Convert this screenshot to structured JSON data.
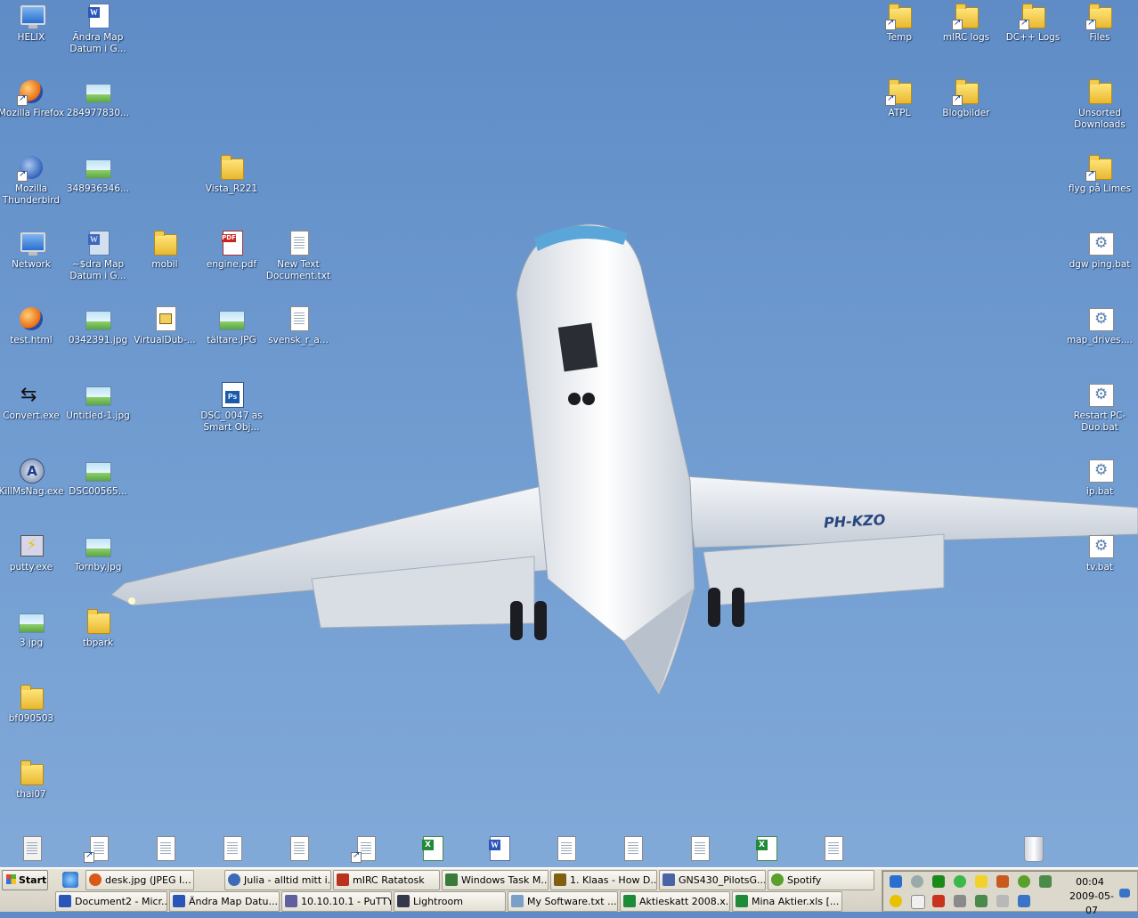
{
  "desktop": {
    "left_icons": [
      {
        "label": "HELIX",
        "icon": "monitor-icon"
      },
      {
        "label": "Ändra Map Datum i G...",
        "icon": "word-document-icon"
      },
      {
        "label": "Mozilla Firefox",
        "icon": "firefox-icon"
      },
      {
        "label": "284977830...",
        "icon": "image-file-icon"
      },
      {
        "label": "Mozilla Thunderbird",
        "icon": "thunderbird-icon"
      },
      {
        "label": "348936346...",
        "icon": "image-file-icon"
      },
      {
        "label": "Vista_R221",
        "icon": "folder-icon"
      },
      {
        "label": "Network",
        "icon": "network-icon"
      },
      {
        "label": "~$dra Map Datum i G...",
        "icon": "word-document-icon"
      },
      {
        "label": "mobil",
        "icon": "folder-icon"
      },
      {
        "label": "engine.pdf",
        "icon": "pdf-file-icon"
      },
      {
        "label": "New Text Document.txt",
        "icon": "text-file-icon"
      },
      {
        "label": "test.html",
        "icon": "firefox-icon"
      },
      {
        "label": "0342391.jpg",
        "icon": "image-file-icon"
      },
      {
        "label": "VirtualDub-...",
        "icon": "virtualdub-icon"
      },
      {
        "label": "tältare.JPG",
        "icon": "image-file-icon"
      },
      {
        "label": "svensk_r_a...",
        "icon": "text-file-icon"
      },
      {
        "label": "Convert.exe",
        "icon": "convert-arrows-icon"
      },
      {
        "label": "Untitled-1.jpg",
        "icon": "image-file-icon"
      },
      {
        "label": "DSC_0047 as Smart Obj...",
        "icon": "psd-file-icon"
      },
      {
        "label": "KillMsNag.exe",
        "icon": "killmsnag-icon"
      },
      {
        "label": "DSC00565...",
        "icon": "image-file-icon"
      },
      {
        "label": "putty.exe",
        "icon": "putty-icon"
      },
      {
        "label": "Tornby.jpg",
        "icon": "image-file-icon"
      },
      {
        "label": "3.jpg",
        "icon": "image-file-icon"
      },
      {
        "label": "tbpark",
        "icon": "folder-icon"
      },
      {
        "label": "bf090503",
        "icon": "folder-icon"
      },
      {
        "label": "thai07",
        "icon": "folder-icon"
      }
    ],
    "right_icons": [
      {
        "label": "Temp",
        "icon": "folder-shortcut-icon"
      },
      {
        "label": "mIRC logs",
        "icon": "folder-shortcut-icon"
      },
      {
        "label": "DC++ Logs",
        "icon": "folder-shortcut-icon"
      },
      {
        "label": "Files",
        "icon": "folder-shortcut-icon"
      },
      {
        "label": "ATPL",
        "icon": "folder-shortcut-icon"
      },
      {
        "label": "Blogbilder",
        "icon": "folder-shortcut-icon"
      },
      {
        "label": "Unsorted Downloads",
        "icon": "folder-icon"
      },
      {
        "label": "flyg på Limes",
        "icon": "folder-shortcut-icon"
      },
      {
        "label": "dgw ping.bat",
        "icon": "batch-file-icon"
      },
      {
        "label": "map_drives....",
        "icon": "batch-file-icon"
      },
      {
        "label": "Restart PC-Duo.bat",
        "icon": "batch-file-icon"
      },
      {
        "label": "ip.bat",
        "icon": "batch-file-icon"
      },
      {
        "label": "tv.bat",
        "icon": "batch-file-icon"
      }
    ],
    "wallpaper": {
      "registration": "PH-KZO",
      "sky_color": "#6a96cc"
    }
  },
  "taskbar": {
    "start_label": "Start",
    "row1": [
      {
        "label": "desk.jpg (JPEG I...",
        "icon": "firefox-icon",
        "color": "#d85a18"
      },
      {
        "label": "Julia - alltid mitt i...",
        "icon": "browser-icon",
        "color": "#3d6bb8"
      },
      {
        "label": "mIRC Ratatosk",
        "icon": "mirc-icon",
        "color": "#b8321e"
      },
      {
        "label": "Windows Task M...",
        "icon": "task-manager-icon",
        "color": "#3a7a3a"
      },
      {
        "label": "1. Klaas - How D...",
        "icon": "pen-icon",
        "color": "#806010"
      },
      {
        "label": "GNS430_PilotsG...",
        "icon": "document-icon",
        "color": "#4a64a8"
      },
      {
        "label": "Spotify",
        "icon": "spotify-icon",
        "color": "#5aa02c"
      }
    ],
    "row2": [
      {
        "label": "Document2 - Micr...",
        "icon": "word-icon",
        "color": "#2a56b8"
      },
      {
        "label": "Ändra Map Datu...",
        "icon": "word-icon",
        "color": "#2a56b8"
      },
      {
        "label": "10.10.10.1 - PuTTY",
        "icon": "putty-icon",
        "color": "#6060a0"
      },
      {
        "label": "Lightroom",
        "icon": "lightroom-icon",
        "color": "#34384a"
      },
      {
        "label": "My Software.txt ...",
        "icon": "notepad-icon",
        "color": "#7aa0c8"
      },
      {
        "label": "Aktieskatt 2008.x...",
        "icon": "excel-icon",
        "color": "#1f8a3a"
      },
      {
        "label": "Mina Aktier.xls [...",
        "icon": "excel-icon",
        "color": "#1f8a3a"
      }
    ],
    "clock": {
      "time": "00:04",
      "date": "2009-05-07"
    }
  }
}
